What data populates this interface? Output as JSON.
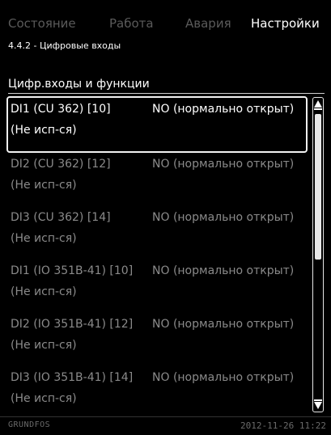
{
  "tabs": [
    {
      "label": "Состояние",
      "active": false
    },
    {
      "label": "Работа",
      "active": false
    },
    {
      "label": "Авария",
      "active": false
    },
    {
      "label": "Настройки",
      "active": true
    }
  ],
  "breadcrumb": "4.4.2 - Цифровые входы",
  "section_title": "Цифр.входы и функции",
  "rows": [
    {
      "input": "DI1 (CU 362) [10]",
      "function": "(Не исп-ся)",
      "mode": "NO (нормально открыт)",
      "selected": true
    },
    {
      "input": "DI2 (CU 362) [12]",
      "function": "(Не исп-ся)",
      "mode": "NO (нормально открыт)",
      "selected": false
    },
    {
      "input": "DI3 (CU 362) [14]",
      "function": "(Не исп-ся)",
      "mode": "NO (нормально открыт)",
      "selected": false
    },
    {
      "input": "DI1 (IO 351B-41) [10]",
      "function": "(Не исп-ся)",
      "mode": "NO (нормально открыт)",
      "selected": false
    },
    {
      "input": "DI2 (IO 351B-41) [12]",
      "function": "(Не исп-ся)",
      "mode": "NO (нормально открыт)",
      "selected": false
    },
    {
      "input": "DI3 (IO 351B-41) [14]",
      "function": "(Не исп-ся)",
      "mode": "NO (нормально открыт)",
      "selected": false
    }
  ],
  "footer": {
    "brand": "GRUNDFOS",
    "datetime": "2012-11-26 11:22"
  },
  "colors": {
    "background": "#000000",
    "text_active": "#ffffff",
    "text_inactive": "#8a8a8a",
    "tab_inactive": "#5a5a5a"
  }
}
